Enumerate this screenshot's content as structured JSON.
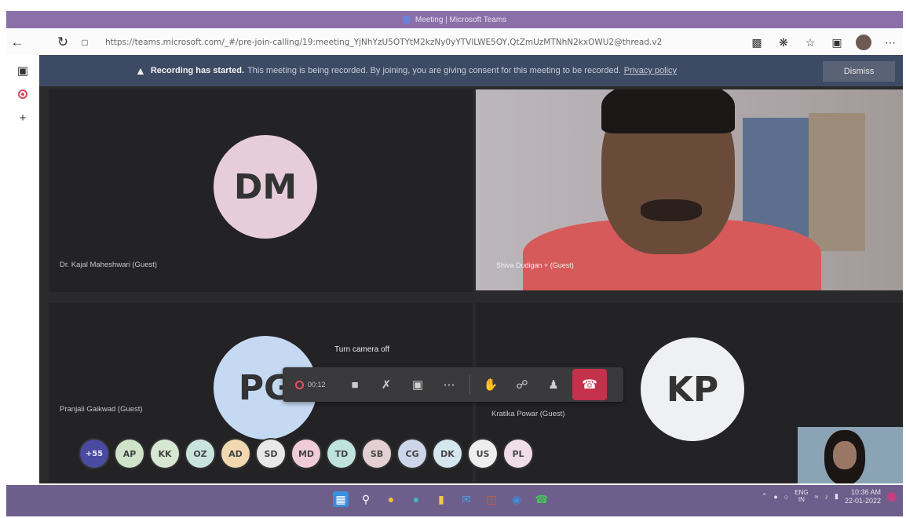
{
  "browser": {
    "title": "Meeting | Microsoft Teams",
    "url": "https://teams.microsoft.com/_#/pre-join-calling/19:meeting_YjNhYzU5OTYtM2kzNy0yYTVlLWE5OY,QtZmUzMTNhN2kxOWU2@thread.v2",
    "icons": {
      "back": "back-arrow-icon",
      "refresh": "refresh-icon",
      "lock": "lock-icon"
    }
  },
  "banner": {
    "bold": "Recording has started.",
    "message": "This meeting is being recorded. By joining, you are giving consent for this meeting to be recorded.",
    "link": "Privacy policy",
    "dismiss": "Dismiss"
  },
  "tiles": {
    "dm": {
      "initials": "DM",
      "name": "Dr. Kajal Maheshwari (Guest)",
      "color": "#e6cdd9"
    },
    "video": {
      "name": "Shiva Dudigan + (Guest)"
    },
    "pg": {
      "initials": "PG",
      "name": "Pranjali Gaikwad (Guest)",
      "color": "#c5d9f2"
    },
    "kp": {
      "initials": "KP",
      "name": "Kratika Powar (Guest)",
      "color": "#eef0f2"
    }
  },
  "tooltip": "Turn camera off",
  "controls": {
    "timer": "00:12",
    "leave_color": "#c4314b"
  },
  "participants": [
    {
      "initials": "+55",
      "color": "#4a4aa0"
    },
    {
      "initials": "AP",
      "color": "#cfe3c9"
    },
    {
      "initials": "KK",
      "color": "#d6e7d2"
    },
    {
      "initials": "OZ",
      "color": "#c9e4df"
    },
    {
      "initials": "AD",
      "color": "#f1d8b0"
    },
    {
      "initials": "SD",
      "color": "#e8e8e8"
    },
    {
      "initials": "MD",
      "color": "#efcbd8"
    },
    {
      "initials": "TD",
      "color": "#bfe3dd"
    },
    {
      "initials": "SB",
      "color": "#e4d0d4"
    },
    {
      "initials": "CG",
      "color": "#cdd5ea"
    },
    {
      "initials": "DK",
      "color": "#d4e6ee"
    },
    {
      "initials": "US",
      "color": "#eeeeee"
    },
    {
      "initials": "PL",
      "color": "#f0dde8"
    }
  ],
  "taskbar": {
    "lang_top": "ENG",
    "lang_bottom": "IN",
    "time": "10:36 AM",
    "date": "22-01-2022"
  }
}
